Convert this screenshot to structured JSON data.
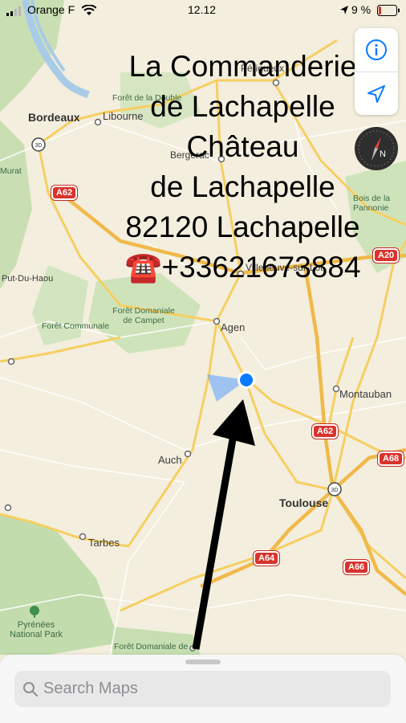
{
  "status_bar": {
    "carrier": "Orange F",
    "time": "12.12",
    "battery": "9 %"
  },
  "map": {
    "places": {
      "bordeaux": "Bordeaux",
      "libourne": "Libourne",
      "perigueux": "Périgueux",
      "bergerac": "Bergerac",
      "villeneuve": "Villeneuve-sur-Lot",
      "agen": "Agen",
      "montauban": "Montauban",
      "auch": "Auch",
      "toulouse": "Toulouse",
      "tarbes": "Tarbes",
      "put_du_haou": "Put-Du-Haou",
      "murat": "Murat",
      "foret_double": "Forêt de la Double",
      "foret_campet": "Forêt Domaniale de Campet",
      "foret_communale": "Forêt Communale",
      "bois_pannonie": "Bois de la Pannonie",
      "pyrenees": "Pyrénées National Park",
      "foret_bottom": "Forêt Domaniale de"
    },
    "shields": {
      "a62_west": "A62",
      "a20": "A20",
      "a62_east": "A62",
      "a68": "A68",
      "a64": "A64",
      "a66": "A66"
    },
    "badge_3d": "3D"
  },
  "overlay": {
    "line1": "La Commanderie",
    "line2": "de Lachapelle",
    "line3": "Château",
    "line4": "de Lachapelle",
    "line5": "82120 Lachapelle",
    "line6": "☎️+33621673884"
  },
  "controls": {
    "info_icon": "info-icon",
    "location_icon": "location-arrow-icon",
    "compass_letter": "N"
  },
  "search": {
    "placeholder": "Search Maps"
  },
  "colors": {
    "accent": "#0a7aff",
    "shield_red": "#d8332c",
    "water": "#a8cbe8",
    "forest": "#c5dcb0"
  }
}
